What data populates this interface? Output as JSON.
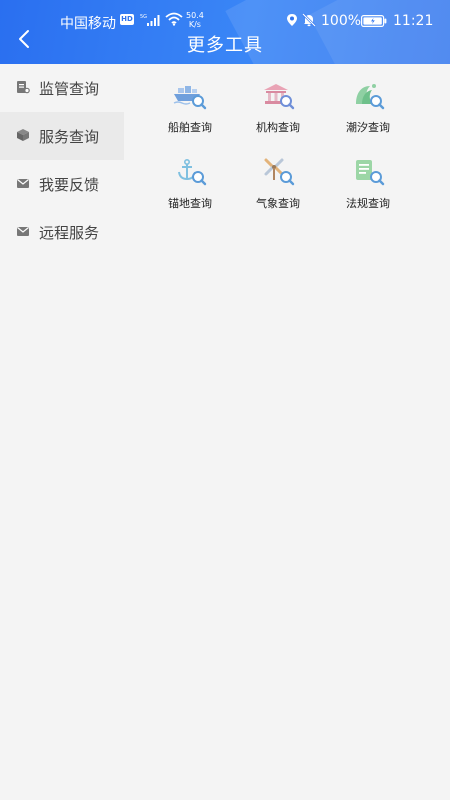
{
  "status_bar": {
    "carrier": "中国移动",
    "hd": "HD",
    "net_speed_value": "50.4",
    "net_speed_unit": "K/s",
    "battery": "100%",
    "time": "11:21"
  },
  "header": {
    "title": "更多工具"
  },
  "sidebar": {
    "items": [
      {
        "label": "监管查询",
        "icon": "document-icon"
      },
      {
        "label": "服务查询",
        "icon": "box-icon"
      },
      {
        "label": "我要反馈",
        "icon": "mail-icon"
      },
      {
        "label": "远程服务",
        "icon": "mail-icon"
      }
    ],
    "selected_index": 1
  },
  "tools": [
    {
      "label": "船舶查询",
      "icon": "ship-search-icon"
    },
    {
      "label": "机构查询",
      "icon": "building-search-icon"
    },
    {
      "label": "潮汐查询",
      "icon": "tide-search-icon"
    },
    {
      "label": "锚地查询",
      "icon": "anchor-search-icon"
    },
    {
      "label": "气象查询",
      "icon": "weather-search-icon"
    },
    {
      "label": "法规查询",
      "icon": "law-search-icon"
    }
  ],
  "colors": {
    "header_blue": "#2f74ee",
    "sidebar_active": "#eaeaea",
    "icon_magnifier": "#5b9bd8",
    "text_dark": "#222222",
    "text_sidebar": "#444444"
  }
}
